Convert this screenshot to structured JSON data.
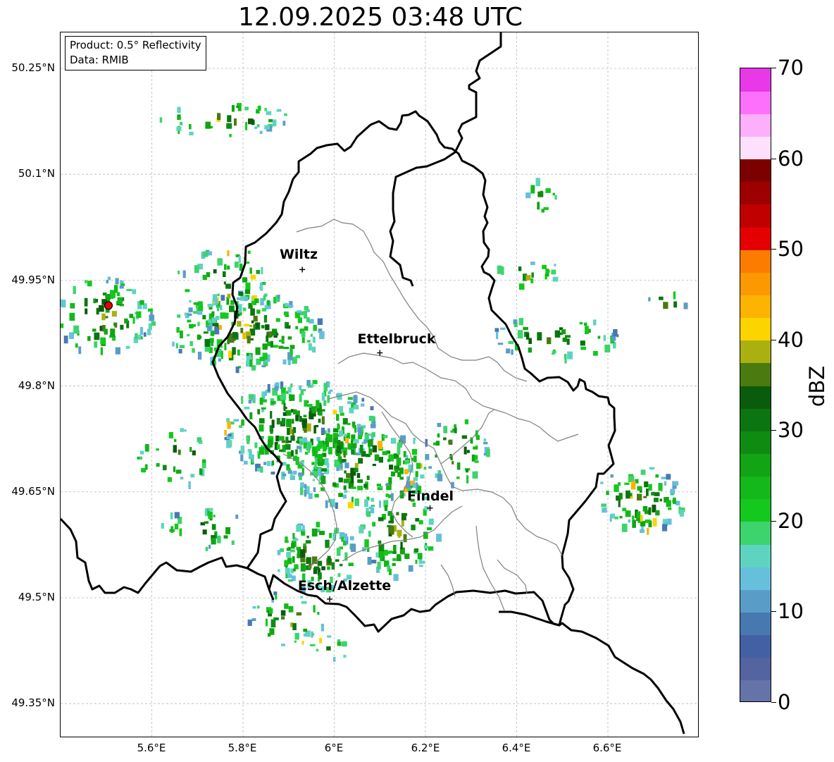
{
  "title": "12.09.2025 03:48 UTC",
  "info": {
    "product": "Product: 0.5° Reflectivity",
    "source": "Data: RMIB"
  },
  "map": {
    "x_ticks": [
      "5.6°E",
      "5.8°E",
      "6°E",
      "6.2°E",
      "6.4°E",
      "6.6°E"
    ],
    "y_ticks": [
      "50.25°N",
      "50.1°N",
      "49.95°N",
      "49.8°N",
      "49.65°N",
      "49.5°N",
      "49.35°N"
    ],
    "grid": true,
    "cities": [
      {
        "name": "Wiltz",
        "lon": 5.93,
        "lat": 49.965
      },
      {
        "name": "Ettelbruck",
        "lon": 6.1,
        "lat": 49.847
      },
      {
        "name": "Findel",
        "lon": 6.21,
        "lat": 49.627
      },
      {
        "name": "Esch/Alzette",
        "lon": 5.99,
        "lat": 49.498
      }
    ],
    "radar_site": {
      "lon": 5.505,
      "lat": 49.914,
      "color": "#e00000"
    }
  },
  "colorbar": {
    "label": "dBZ",
    "ticks": [
      "0",
      "10",
      "20",
      "30",
      "40",
      "50",
      "60",
      "70"
    ],
    "min": 0,
    "max": 70,
    "colors": [
      "#6474a8",
      "#5464a0",
      "#4460a4",
      "#4878b0",
      "#5a9cc8",
      "#66c0dc",
      "#5ed4c0",
      "#3cd46c",
      "#14c81e",
      "#14b81a",
      "#12a414",
      "#0e8c12",
      "#0c7410",
      "#0a5c0c",
      "#4a7a10",
      "#aab010",
      "#fcd400",
      "#fcb400",
      "#fc9800",
      "#fc7c00",
      "#e40000",
      "#c00000",
      "#9c0000",
      "#7c0000",
      "#fce0fc",
      "#fcb0fc",
      "#fc70fc",
      "#e838e8"
    ]
  }
}
